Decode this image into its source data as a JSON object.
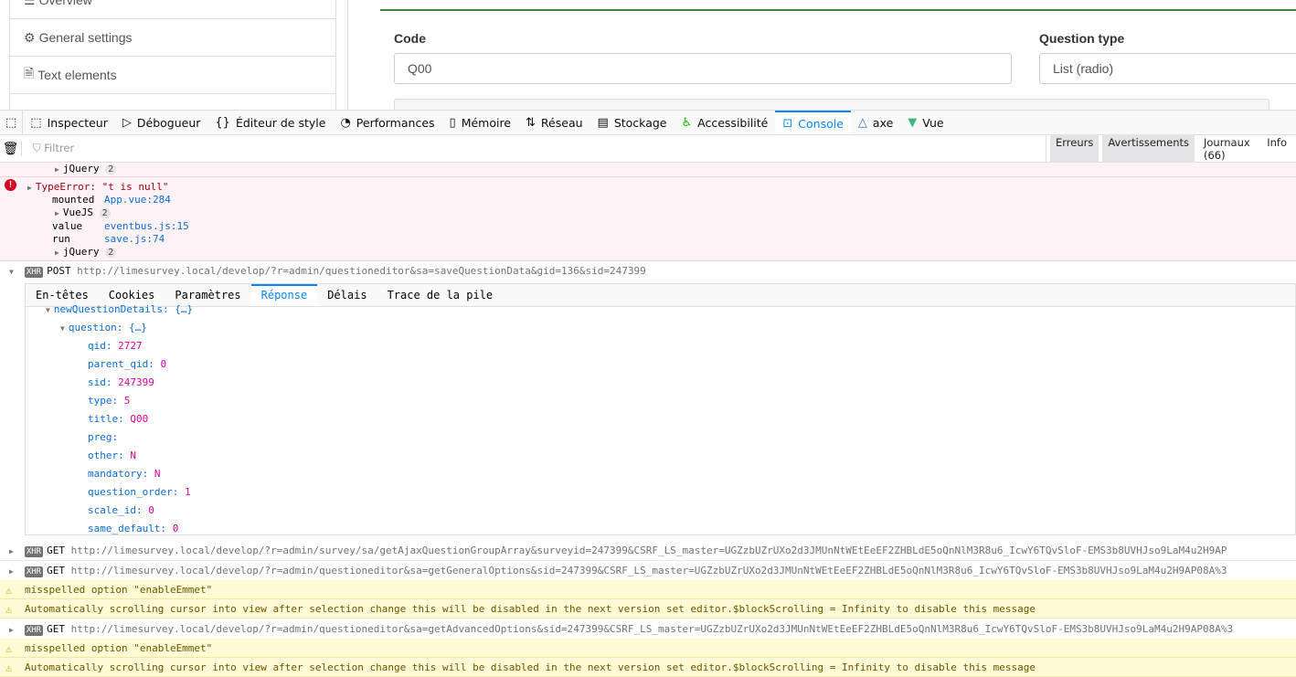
{
  "page": {
    "sidebar": [
      "Overview",
      "General settings",
      "Text elements"
    ],
    "code_label": "Code",
    "code_value": "Q00",
    "qtype_label": "Question type",
    "qtype_value": "List (radio)"
  },
  "devtools": {
    "tabs": [
      {
        "label": "Inspecteur",
        "icon": "inspector-icon"
      },
      {
        "label": "Débogueur",
        "icon": "debugger-icon"
      },
      {
        "label": "Éditeur de style",
        "icon": "style-editor-icon"
      },
      {
        "label": "Performances",
        "icon": "performance-icon"
      },
      {
        "label": "Mémoire",
        "icon": "memory-icon"
      },
      {
        "label": "Réseau",
        "icon": "network-icon"
      },
      {
        "label": "Stockage",
        "icon": "storage-icon"
      },
      {
        "label": "Accessibilité",
        "icon": "accessibility-icon"
      },
      {
        "label": "Console",
        "icon": "console-icon"
      },
      {
        "label": "axe",
        "icon": "axe-icon"
      },
      {
        "label": "Vue",
        "icon": "vue-icon"
      }
    ],
    "filter_placeholder": "Filtrer",
    "filters": [
      "Erreurs",
      "Avertissements",
      "Journaux (66)",
      "Info"
    ]
  },
  "console": {
    "jquery1": {
      "name": "jQuery",
      "count": "2"
    },
    "error": {
      "message": "TypeError: \"t is null\"",
      "stack": [
        {
          "fn": "mounted",
          "loc": "App.vue:284"
        },
        {
          "fn": "VueJS",
          "count": "2"
        },
        {
          "fn": "value",
          "loc": "eventbus.js:15"
        },
        {
          "fn": "run",
          "loc": "save.js:74"
        },
        {
          "fn": "jQuery",
          "count": "2"
        }
      ]
    },
    "post": {
      "badge": "XHR",
      "method": "POST",
      "url": "http://limesurvey.local/develop/?r=admin/questioneditor&sa=saveQuestionData&gid=136&sid=247399"
    },
    "panel_tabs": [
      "En-têtes",
      "Cookies",
      "Paramètres",
      "Réponse",
      "Délais",
      "Trace de la pile"
    ],
    "tree_parent": "newQuestionDetails: {…}",
    "tree_question": "question: {…}",
    "fields": [
      {
        "k": "qid:",
        "v": "2727"
      },
      {
        "k": "parent_qid:",
        "v": "0"
      },
      {
        "k": "sid:",
        "v": "247399"
      },
      {
        "k": "type:",
        "v": "5"
      },
      {
        "k": "title:",
        "v": "Q00"
      },
      {
        "k": "preg:",
        "v": ""
      },
      {
        "k": "other:",
        "v": "N"
      },
      {
        "k": "mandatory:",
        "v": "N"
      },
      {
        "k": "question_order:",
        "v": "1"
      },
      {
        "k": "scale_id:",
        "v": "0"
      },
      {
        "k": "same_default:",
        "v": "0"
      }
    ],
    "rows": [
      {
        "type": "xhr",
        "method": "GET",
        "url": "http://limesurvey.local/develop/?r=admin/survey/sa/getAjaxQuestionGroupArray&surveyid=247399&CSRF_LS_master=UGZzbUZrUXo2d3JMUnNtWEtEeEF2ZHBLdE5oQnNlM3R8u6_IcwY6TQvSloF-EMS3b8UVHJso9LaM4u2H9AP"
      },
      {
        "type": "xhr",
        "method": "GET",
        "url": "http://limesurvey.local/develop/?r=admin/questioneditor&sa=getGeneralOptions&sid=247399&CSRF_LS_master=UGZzbUZrUXo2d3JMUnNtWEtEeEF2ZHBLdE5oQnNlM3R8u6_IcwY6TQvSloF-EMS3b8UVHJso9LaM4u2H9AP08A%3"
      },
      {
        "type": "warn",
        "text": "misspelled option \"enableEmmet\""
      },
      {
        "type": "warn",
        "text": "Automatically scrolling cursor into view after selection change this will be disabled in the next version set editor.$blockScrolling = Infinity to disable this message"
      },
      {
        "type": "xhr",
        "method": "GET",
        "url": "http://limesurvey.local/develop/?r=admin/questioneditor&sa=getAdvancedOptions&sid=247399&CSRF_LS_master=UGZzbUZrUXo2d3JMUnNtWEtEeEF2ZHBLdE5oQnNlM3R8u6_IcwY6TQvSloF-EMS3b8UVHJso9LaM4u2H9AP08A%3"
      },
      {
        "type": "warn",
        "text": "misspelled option \"enableEmmet\""
      },
      {
        "type": "warn",
        "text": "Automatically scrolling cursor into view after selection change this will be disabled in the next version set editor.$blockScrolling = Infinity to disable this message"
      }
    ]
  }
}
